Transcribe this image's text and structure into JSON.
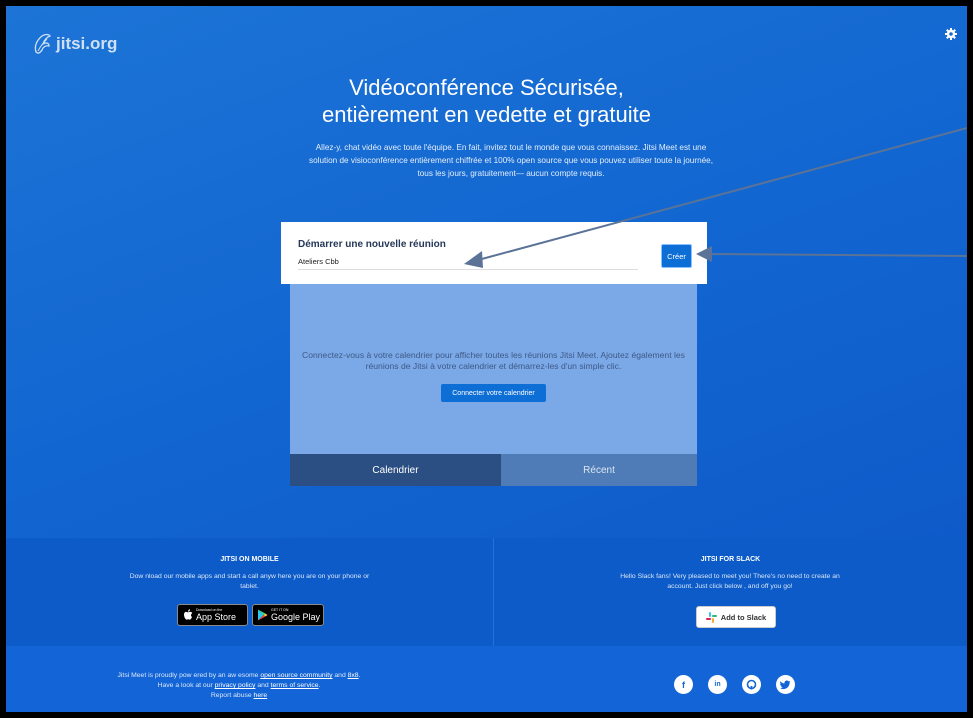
{
  "logo": {
    "text": "jitsi.org",
    "icon": "jitsi-logo-icon"
  },
  "settings": {
    "icon": "gear-icon"
  },
  "hero": {
    "title_line1": "Vidéoconférence Sécurisée,",
    "title_line2": "entièrement en vedette et gratuite",
    "description": "Allez-y, chat vidéo avec toute l'équipe. En fait, invitez tout le monde que vous connaissez. Jitsi Meet est une solution de visioconférence entièrement chiffrée et 100% open source que vous pouvez utiliser toute la journée, tous les jours, gratuitement— aucun compte requis."
  },
  "join": {
    "label": "Démarrer une nouvelle réunion",
    "room_value": "Ateliers Cbb",
    "create_label": "Créer"
  },
  "calendar": {
    "message": "Connectez-vous à votre calendrier pour afficher toutes les réunions Jitsi Meet. Ajoutez également les réunions de Jitsi à votre calendrier et démarrez-les d'un simple clic.",
    "connect_label": "Connecter votre calendrier"
  },
  "tabs": {
    "calendar": "Calendrier",
    "recent": "Récent"
  },
  "mobile": {
    "title": "JITSI ON MOBILE",
    "text": "Dow nload our mobile apps and start a call anyw here you are on your phone or tablet.",
    "appstore_small": "Download on the",
    "appstore_big": "App Store",
    "googleplay_small": "GET IT ON",
    "googleplay_big": "Google Play"
  },
  "slack": {
    "title": "JITSI FOR SLACK",
    "text": "Hello Slack fans! Very pleased to meet you! There's no need to create an account. Just click below , and off you go!",
    "button": "Add to Slack"
  },
  "footer": {
    "line1_prefix": "Jitsi Meet is proudly pow ered by an aw esome ",
    "line1_link1": "open source community",
    "line1_and": " and ",
    "line1_link2": "8x8",
    "line1_suffix": ".",
    "line2_prefix": "Have a look at our ",
    "line2_link1": "privacy policy",
    "line2_and": " and ",
    "line2_link2": "terms of service",
    "line2_suffix": ".",
    "line3_prefix": "Report abuse ",
    "line3_link": "here",
    "social": [
      "facebook-icon",
      "linkedin-icon",
      "github-icon",
      "twitter-icon"
    ]
  },
  "colors": {
    "brand_blue": "#1266d1",
    "button_blue": "#0d6ed6",
    "arrow": "#5a7396"
  }
}
